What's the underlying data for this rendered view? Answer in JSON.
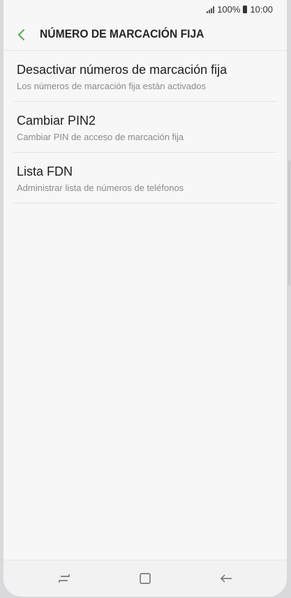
{
  "status_bar": {
    "battery_percent": "100%",
    "time": "10:00"
  },
  "header": {
    "title": "NÚMERO DE MARCACIÓN FIJA",
    "back_icon": "chevron-left-icon",
    "accent_color": "#4caf50"
  },
  "items": [
    {
      "title": "Desactivar números de marcación fija",
      "subtitle": "Los números de marcación fija están activados"
    },
    {
      "title": "Cambiar PIN2",
      "subtitle": "Cambiar PIN de acceso de marcación fija"
    },
    {
      "title": "Lista FDN",
      "subtitle": "Administrar lista de números de teléfonos"
    }
  ],
  "navbar": {
    "recent_icon": "recent-apps-icon",
    "home_icon": "home-icon",
    "back_icon": "back-arrow-icon"
  }
}
